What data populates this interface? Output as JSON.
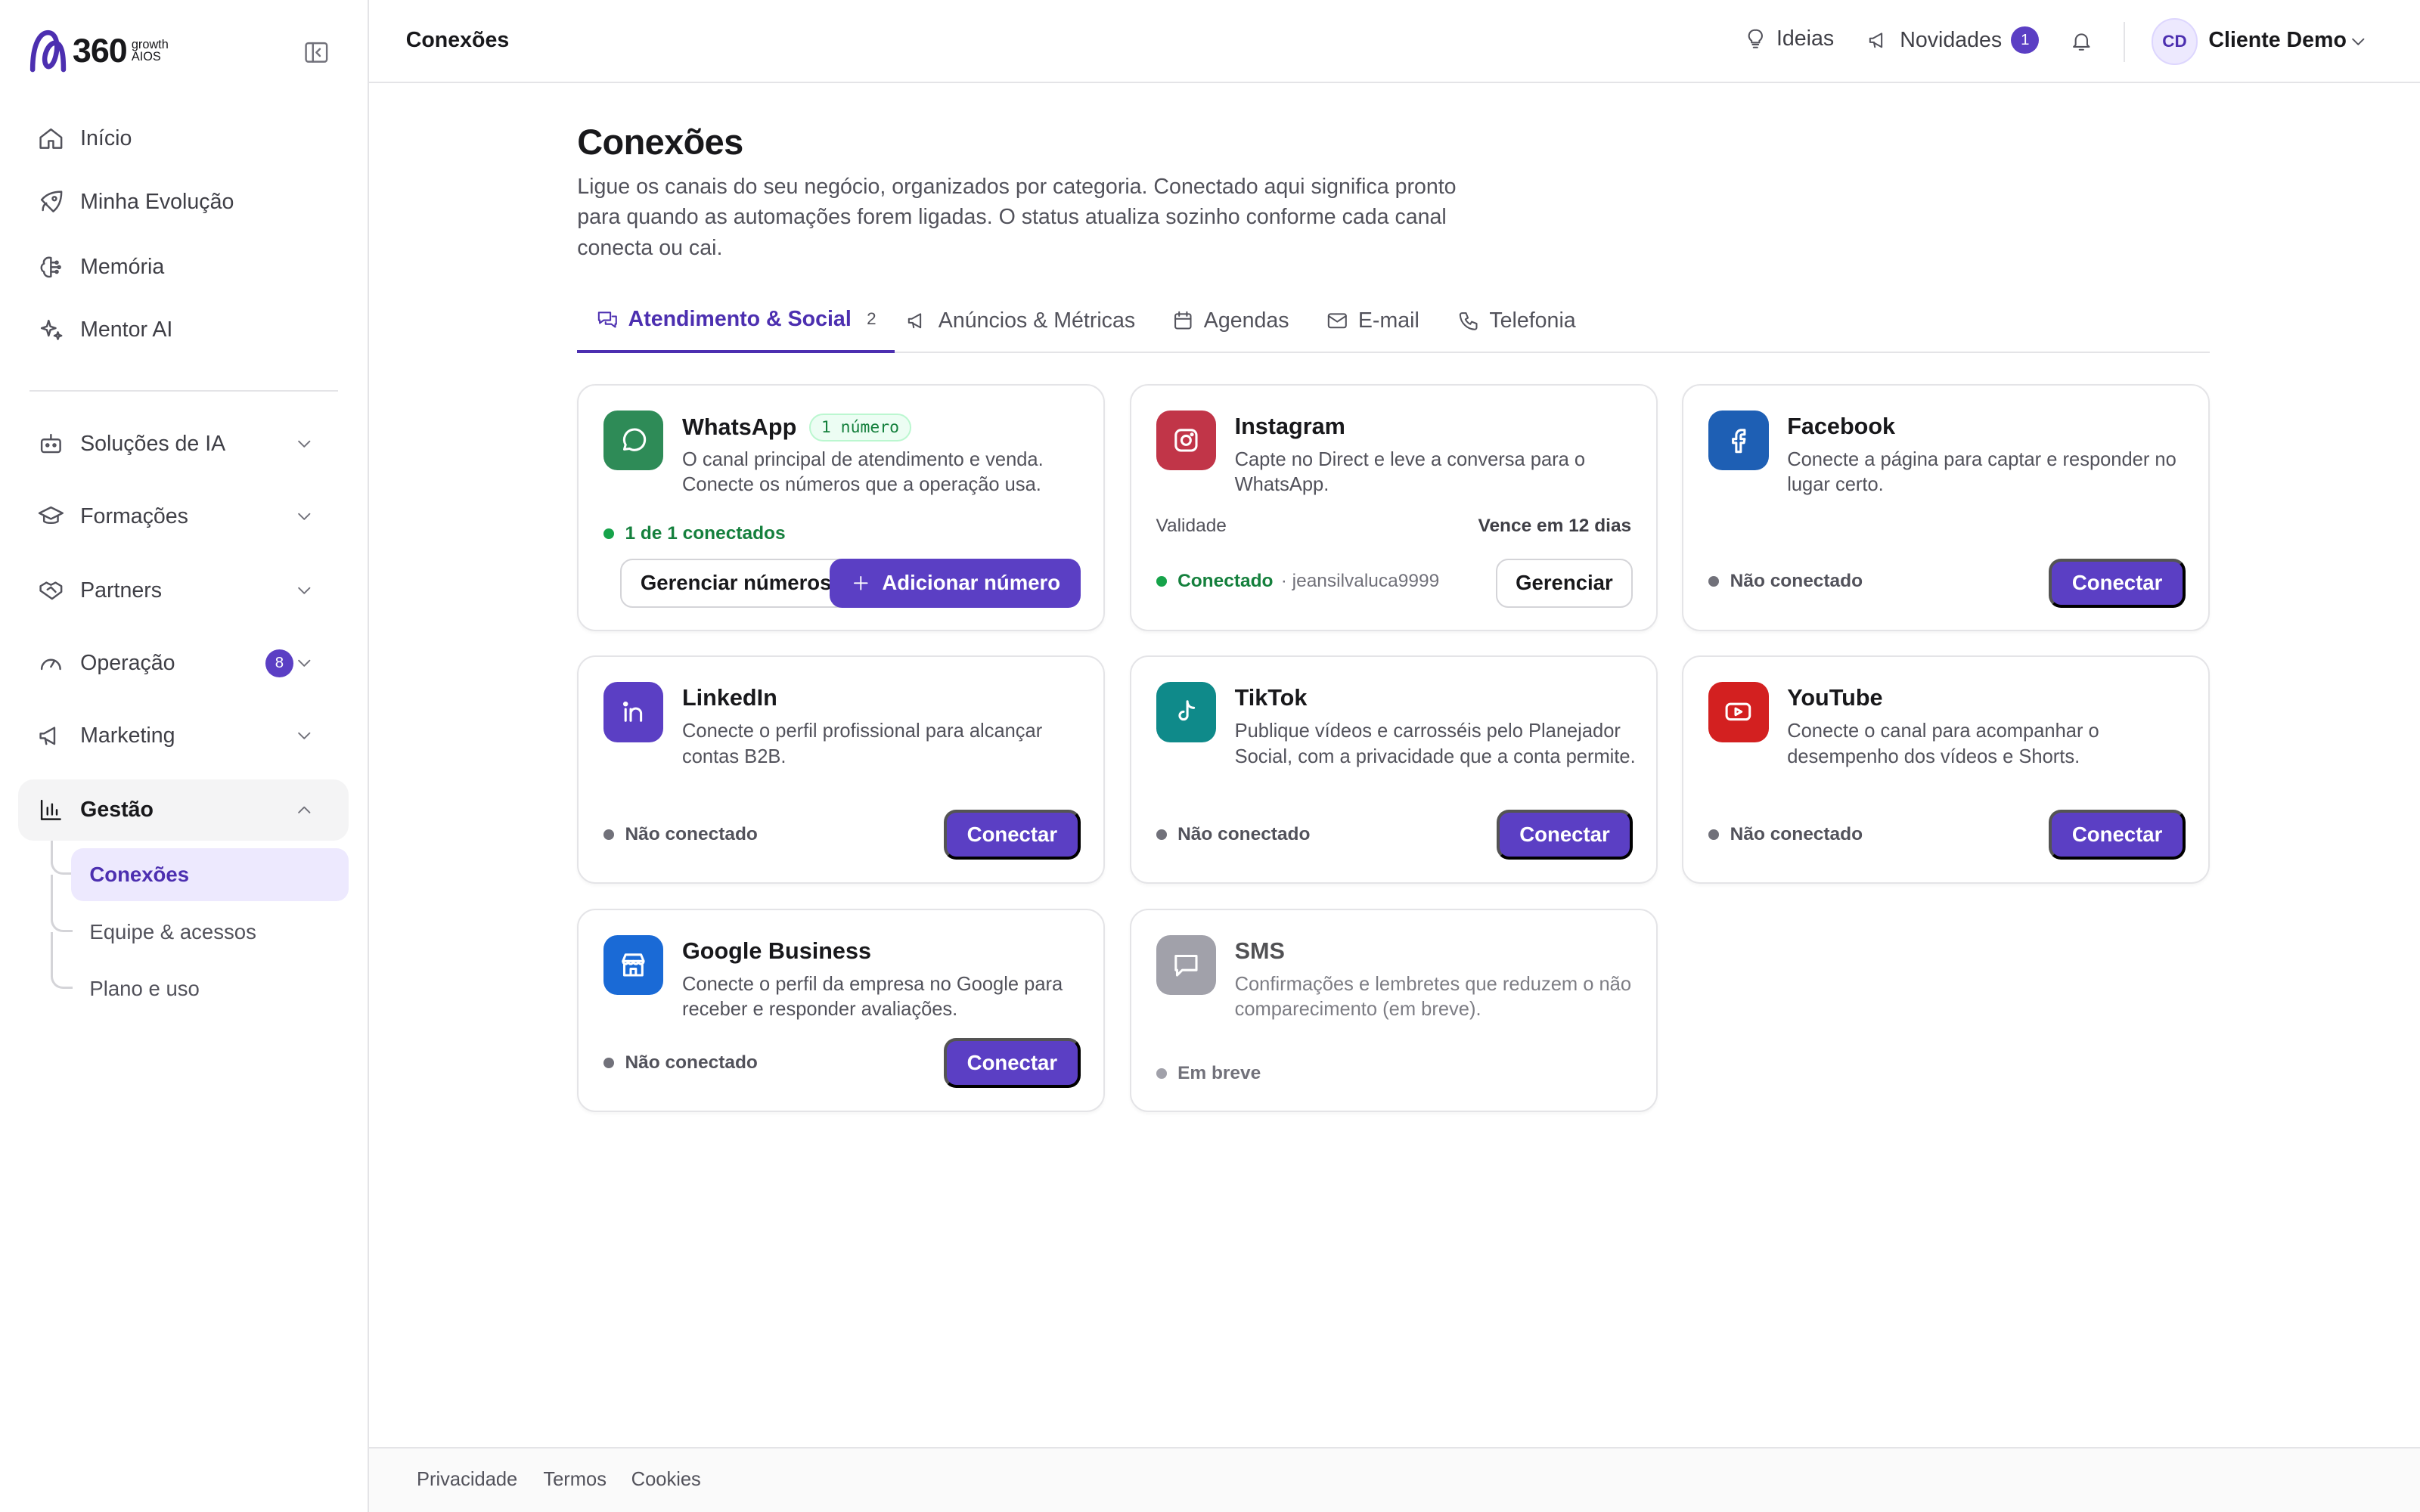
{
  "brand": {
    "logo_number": "360",
    "logo_sub1": "growth",
    "logo_sub2": "AIOS"
  },
  "sidebar": {
    "items": [
      {
        "label": "Início"
      },
      {
        "label": "Minha Evolução"
      },
      {
        "label": "Memória"
      },
      {
        "label": "Mentor AI"
      }
    ],
    "groups": [
      {
        "label": "Soluções de IA"
      },
      {
        "label": "Formações"
      },
      {
        "label": "Partners"
      },
      {
        "label": "Operação",
        "badge": "8"
      },
      {
        "label": "Marketing"
      },
      {
        "label": "Gestão"
      }
    ],
    "subitems": [
      {
        "label": "Conexões"
      },
      {
        "label": "Equipe & acessos"
      },
      {
        "label": "Plano e uso"
      }
    ]
  },
  "header": {
    "crumb": "Conexões",
    "ideias": "Ideias",
    "novidades": "Novidades",
    "novidades_count": "1",
    "user_initials": "CD",
    "user_name": "Cliente Demo"
  },
  "main": {
    "title": "Conexões",
    "subtitle": "Ligue os canais do seu negócio, organizados por categoria. Conectado aqui significa pronto para quando as automações forem ligadas. O status atualiza sozinho conforme cada canal conecta ou cai.",
    "tabs": [
      {
        "label": "Atendimento & Social",
        "count": "2"
      },
      {
        "label": "Anúncios & Métricas"
      },
      {
        "label": "Agendas"
      },
      {
        "label": "E-mail"
      },
      {
        "label": "Telefonia"
      }
    ]
  },
  "cards": {
    "whatsapp": {
      "title": "WhatsApp",
      "chip": "1 número",
      "desc": "O canal principal de atendimento e venda. Conecte os números que a operação usa.",
      "status": "1 de 1 conectados",
      "btn_manage": "Gerenciar números",
      "btn_add": "Adicionar número"
    },
    "instagram": {
      "title": "Instagram",
      "desc": "Capte no Direct e leve a conversa para o WhatsApp.",
      "validade_label": "Validade",
      "validade_value": "Vence em 12 dias",
      "status": "Conectado",
      "handle": "· jeansilvaluca9999",
      "btn": "Gerenciar"
    },
    "facebook": {
      "title": "Facebook",
      "desc": "Conecte a página para captar e responder no lugar certo.",
      "status": "Não conectado",
      "btn": "Conectar"
    },
    "linkedin": {
      "title": "LinkedIn",
      "desc": "Conecte o perfil profissional para alcançar contas B2B.",
      "status": "Não conectado",
      "btn": "Conectar"
    },
    "tiktok": {
      "title": "TikTok",
      "desc": "Publique vídeos e carrosséis pelo Planejador Social, com a privacidade que a conta permite.",
      "status": "Não conectado",
      "btn": "Conectar"
    },
    "youtube": {
      "title": "YouTube",
      "desc": "Conecte o canal para acompanhar o desempenho dos vídeos e Shorts.",
      "status": "Não conectado",
      "btn": "Conectar"
    },
    "google": {
      "title": "Google Business",
      "desc": "Conecte o perfil da empresa no Google para receber e responder avaliações.",
      "status": "Não conectado",
      "btn": "Conectar"
    },
    "sms": {
      "title": "SMS",
      "desc": "Confirmações e lembretes que reduzem o não comparecimento (em breve).",
      "status": "Em breve"
    }
  },
  "colors": {
    "accent": "#5b3fc4",
    "whatsapp": "#2e8b57",
    "instagram": "#c13548",
    "facebook": "#1e5fb4",
    "linkedin": "#5b3fc4",
    "tiktok": "#0f8a8a",
    "youtube": "#d32020",
    "google": "#1a6ad6",
    "sms": "#a1a1aa"
  },
  "footer": {
    "links": [
      "Privacidade",
      "Termos",
      "Cookies"
    ]
  }
}
